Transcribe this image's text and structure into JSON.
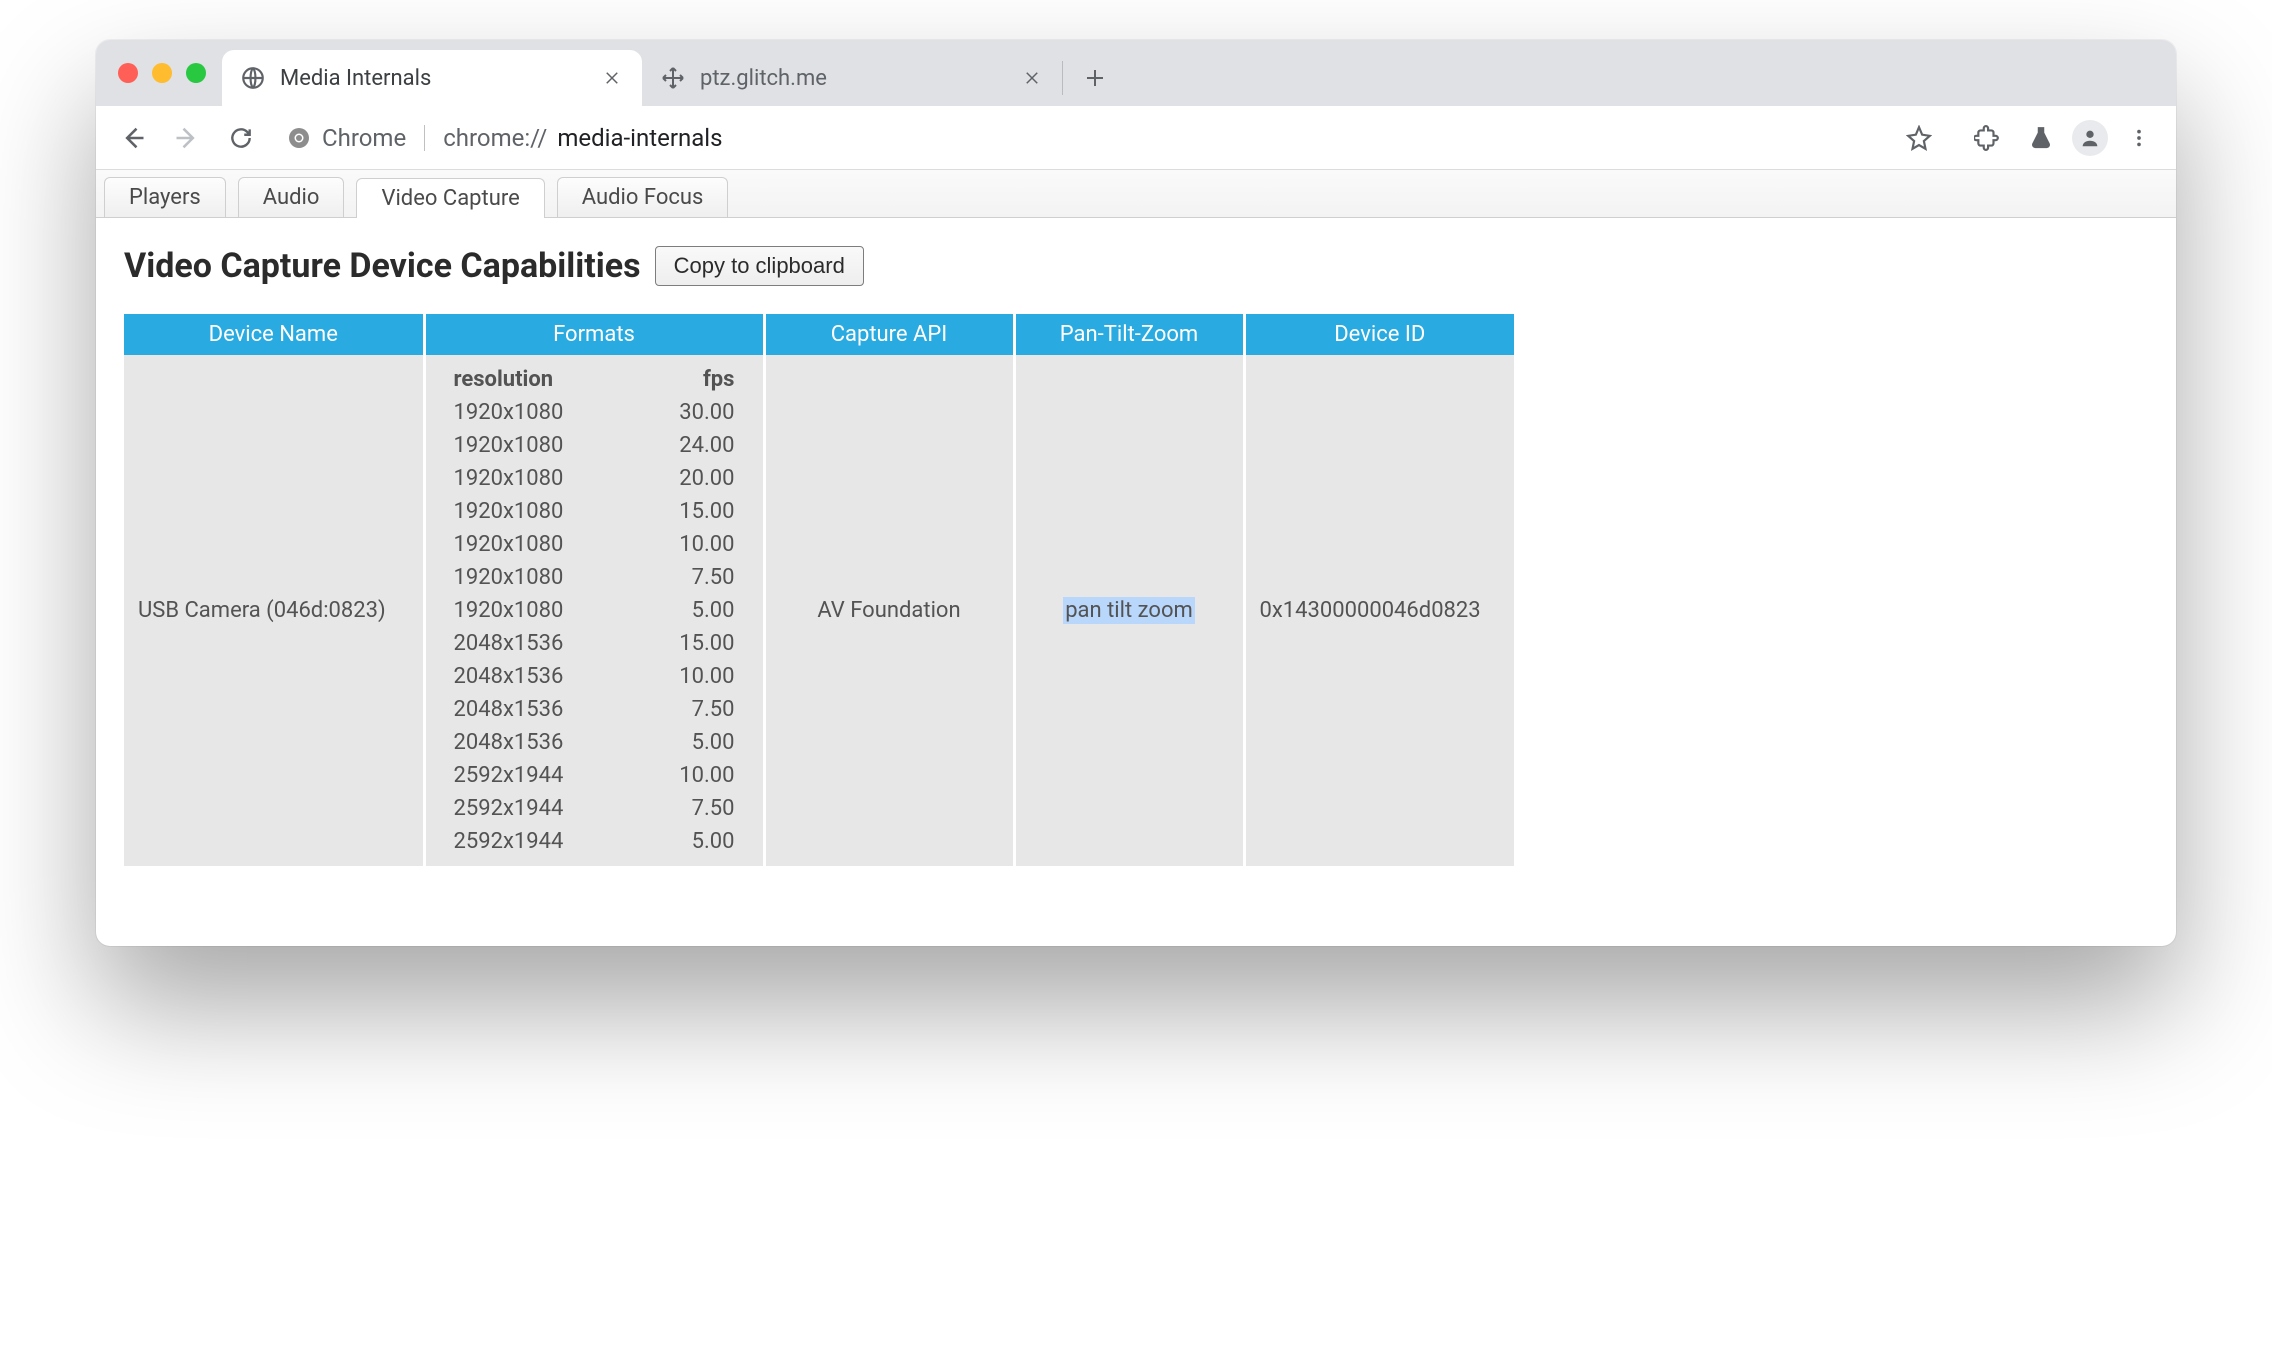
{
  "browser_tabs": [
    {
      "title": "Media Internals",
      "active": true
    },
    {
      "title": "ptz.glitch.me",
      "active": false
    }
  ],
  "omnibox": {
    "chip": "Chrome",
    "url_prefix": "chrome://",
    "url_path": "media-internals"
  },
  "page_tabs": {
    "items": [
      "Players",
      "Audio",
      "Video Capture",
      "Audio Focus"
    ],
    "active_index": 2
  },
  "heading": "Video Capture Device Capabilities",
  "copy_button": "Copy to clipboard",
  "table": {
    "headers": [
      "Device Name",
      "Formats",
      "Capture API",
      "Pan-Tilt-Zoom",
      "Device ID"
    ],
    "row": {
      "device_name": "USB Camera (046d:0823)",
      "capture_api": "AV Foundation",
      "ptz": "pan tilt zoom",
      "device_id": "0x14300000046d0823"
    },
    "formats_header": {
      "resolution": "resolution",
      "fps": "fps"
    },
    "formats": [
      {
        "resolution": "1920x1080",
        "fps": "30.00"
      },
      {
        "resolution": "1920x1080",
        "fps": "24.00"
      },
      {
        "resolution": "1920x1080",
        "fps": "20.00"
      },
      {
        "resolution": "1920x1080",
        "fps": "15.00"
      },
      {
        "resolution": "1920x1080",
        "fps": "10.00"
      },
      {
        "resolution": "1920x1080",
        "fps": "7.50"
      },
      {
        "resolution": "1920x1080",
        "fps": "5.00"
      },
      {
        "resolution": "2048x1536",
        "fps": "15.00"
      },
      {
        "resolution": "2048x1536",
        "fps": "10.00"
      },
      {
        "resolution": "2048x1536",
        "fps": "7.50"
      },
      {
        "resolution": "2048x1536",
        "fps": "5.00"
      },
      {
        "resolution": "2592x1944",
        "fps": "10.00"
      },
      {
        "resolution": "2592x1944",
        "fps": "7.50"
      },
      {
        "resolution": "2592x1944",
        "fps": "5.00"
      }
    ]
  }
}
